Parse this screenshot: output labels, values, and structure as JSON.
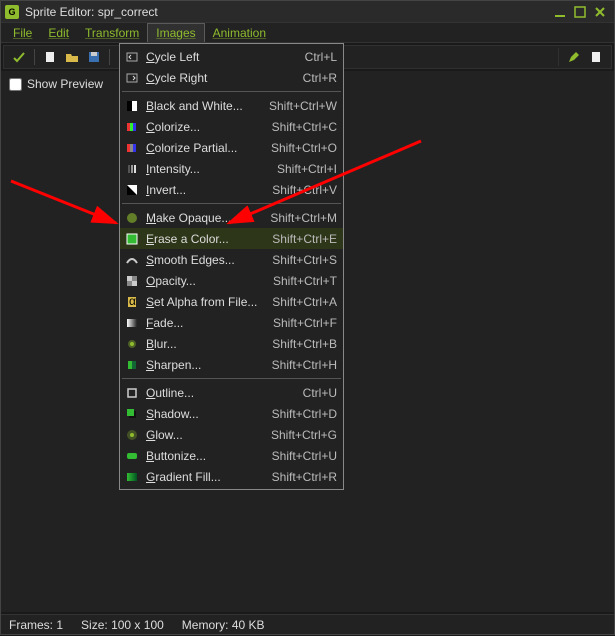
{
  "window": {
    "title": "Sprite Editor: spr_correct",
    "app_badge": "G"
  },
  "menubar": {
    "items": [
      "File",
      "Edit",
      "Transform",
      "Images",
      "Animation"
    ],
    "open_index": 3
  },
  "show_preview_label": "Show Preview",
  "dropdown": {
    "groups": [
      [
        {
          "icon": "cycle-left-icon",
          "label": "Cycle Left",
          "shortcut": "Ctrl+L"
        },
        {
          "icon": "cycle-right-icon",
          "label": "Cycle Right",
          "shortcut": "Ctrl+R"
        }
      ],
      [
        {
          "icon": "bw-icon",
          "label": "Black and White...",
          "shortcut": "Shift+Ctrl+W"
        },
        {
          "icon": "colorize-icon",
          "label": "Colorize...",
          "shortcut": "Shift+Ctrl+C"
        },
        {
          "icon": "colorize-partial-icon",
          "label": "Colorize Partial...",
          "shortcut": "Shift+Ctrl+O"
        },
        {
          "icon": "intensity-icon",
          "label": "Intensity...",
          "shortcut": "Shift+Ctrl+I"
        },
        {
          "icon": "invert-icon",
          "label": "Invert...",
          "shortcut": "Shift+Ctrl+V"
        }
      ],
      [
        {
          "icon": "opaque-icon",
          "label": "Make Opaque...",
          "shortcut": "Shift+Ctrl+M"
        },
        {
          "icon": "erase-color-icon",
          "label": "Erase a Color...",
          "shortcut": "Shift+Ctrl+E",
          "highlight": true
        },
        {
          "icon": "smooth-icon",
          "label": "Smooth Edges...",
          "shortcut": "Shift+Ctrl+S"
        },
        {
          "icon": "opacity-icon",
          "label": "Opacity...",
          "shortcut": "Shift+Ctrl+T"
        },
        {
          "icon": "alpha-file-icon",
          "label": "Set Alpha from File...",
          "shortcut": "Shift+Ctrl+A"
        },
        {
          "icon": "fade-icon",
          "label": "Fade...",
          "shortcut": "Shift+Ctrl+F"
        },
        {
          "icon": "blur-icon",
          "label": "Blur...",
          "shortcut": "Shift+Ctrl+B"
        },
        {
          "icon": "sharpen-icon",
          "label": "Sharpen...",
          "shortcut": "Shift+Ctrl+H"
        }
      ],
      [
        {
          "icon": "outline-icon",
          "label": "Outline...",
          "shortcut": "Ctrl+U"
        },
        {
          "icon": "shadow-icon",
          "label": "Shadow...",
          "shortcut": "Shift+Ctrl+D"
        },
        {
          "icon": "glow-icon",
          "label": "Glow...",
          "shortcut": "Shift+Ctrl+G"
        },
        {
          "icon": "buttonize-icon",
          "label": "Buttonize...",
          "shortcut": "Shift+Ctrl+U"
        },
        {
          "icon": "gradient-icon",
          "label": "Gradient Fill...",
          "shortcut": "Shift+Ctrl+R"
        }
      ]
    ]
  },
  "status": {
    "frames_label": "Frames:",
    "frames_value": "1",
    "size_label": "Size:",
    "size_value": "100 x 100",
    "memory_label": "Memory:",
    "memory_value": "40 KB"
  },
  "colors": {
    "accent": "#8fbc2d",
    "arrow": "#ff0000"
  }
}
